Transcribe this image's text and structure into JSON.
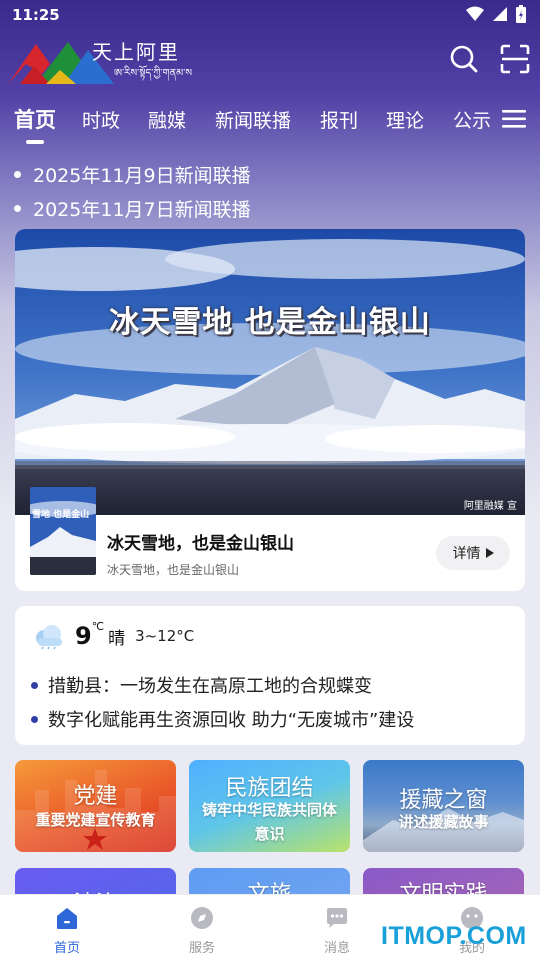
{
  "status": {
    "time": "11:25"
  },
  "brand": {
    "name": "天上阿里",
    "tibetan": "ཨ་རིས་སྟོད་ཀྱི་གནམ་ས"
  },
  "nav": {
    "tabs": [
      "首页",
      "时政",
      "融媒",
      "新闻联播",
      "报刊",
      "理论",
      "公示"
    ],
    "active": "首页"
  },
  "headlines": [
    "2025年11月9日新闻联播",
    "2025年11月7日新闻联播"
  ],
  "hero": {
    "image_title": "冰天雪地  也是金山银山",
    "credit": "阿里融媒 宣",
    "thumb_label": "雪地  也是金山",
    "title": "冰天雪地，也是金山银山",
    "subtitle": "冰天雪地，也是金山银山",
    "detail_label": "详情"
  },
  "weather": {
    "temp": "9",
    "unit": "℃",
    "condition": "晴",
    "range": "3~12°C"
  },
  "news": [
    "措勤县：一场发生在高原工地的合规蝶变",
    "数字化赋能再生资源回收 助力“无废城市”建设"
  ],
  "tiles": [
    {
      "title": "党建",
      "subtitle": "重要党建宣传教育"
    },
    {
      "title": "民族团结",
      "subtitle": "铸牢中华民族共同体意识"
    },
    {
      "title": "援藏之窗",
      "subtitle": "讲述援藏故事"
    },
    {
      "title": "法治",
      "subtitle": ""
    },
    {
      "title": "文旅",
      "subtitle": ""
    },
    {
      "title": "文明实践",
      "subtitle": ""
    }
  ],
  "tabbar": {
    "items": [
      "首页",
      "服务",
      "消息",
      "我的"
    ],
    "active": "首页"
  },
  "watermark": "ITMOP.COM",
  "colors": {
    "accent": "#2d66d6",
    "bullet": "#2f3fa6",
    "header_bg": "#3a2a8c"
  }
}
